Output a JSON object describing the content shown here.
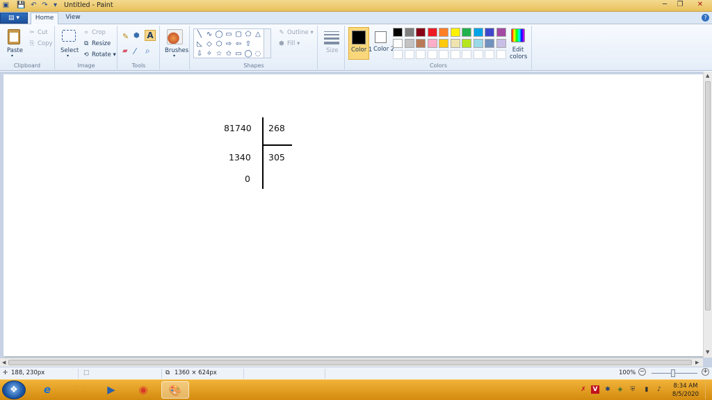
{
  "window": {
    "title": "Untitled - Paint",
    "controls": [
      "─",
      "❐",
      "✕"
    ]
  },
  "quick_access": [
    "▣",
    "💾",
    "↶",
    "↷",
    "▾"
  ],
  "tabs": {
    "file": "▤ ▾",
    "home": "Home",
    "view": "View",
    "help": "?"
  },
  "ribbon": {
    "clipboard": {
      "label": "Clipboard",
      "paste": "Paste",
      "paste_arrow": "▾",
      "cut": "Cut",
      "copy": "Copy"
    },
    "image": {
      "label": "Image",
      "select": "Select",
      "select_arrow": "▾",
      "crop": "Crop",
      "resize": "Resize",
      "rotate": "Rotate ▾"
    },
    "tools": {
      "label": "Tools",
      "pencil": "✎",
      "fill": "⬢",
      "text": "A",
      "eraser": "▰",
      "picker": "⁄",
      "magnifier": "⌕"
    },
    "brushes": {
      "label": "Brushes",
      "arrow": "▾"
    },
    "shapes": {
      "label": "Shapes",
      "glyphs": [
        "╲",
        "∿",
        "◯",
        "▭",
        "▢",
        "⬠",
        "△",
        "◺",
        "◇",
        "⬡",
        "⇨",
        "⇦",
        "⇧",
        "⇩",
        "✧",
        "☆",
        "✩",
        "▭",
        "◯",
        "◌"
      ],
      "outline": "Outline ▾",
      "fill": "Fill ▾"
    },
    "size": {
      "label": "Size"
    },
    "colors": {
      "label": "Colors",
      "color1": "Color 1",
      "color2": "Color 2",
      "edit": "Edit colors",
      "color1_value": "#000000",
      "color2_value": "#ffffff",
      "row1": [
        "#000000",
        "#7f7f7f",
        "#880015",
        "#ed1c24",
        "#ff7f27",
        "#fff200",
        "#22b14c",
        "#00a2e8",
        "#3f48cc",
        "#a349a4"
      ],
      "row2": [
        "#ffffff",
        "#c3c3c3",
        "#b97a57",
        "#ffaec9",
        "#ffc90e",
        "#efe4b0",
        "#b5e61d",
        "#99d9ea",
        "#7092be",
        "#c8bfe7"
      ],
      "row3": [
        "#ffffff",
        "#ffffff",
        "#ffffff",
        "#ffffff",
        "#ffffff",
        "#ffffff",
        "#ffffff",
        "#ffffff",
        "#ffffff",
        "#ffffff"
      ]
    }
  },
  "canvas_text": {
    "dividend": "81740",
    "divisor": "268",
    "product": "1340",
    "quotient": "305",
    "remainder": "0"
  },
  "status": {
    "cursor": "188, 230px",
    "canvas_size": "1360 × 624px",
    "zoom": "100%",
    "zoom_out": "−",
    "zoom_in": "+"
  },
  "taskbar": {
    "start": "❖",
    "apps": [
      {
        "name": "internet-explorer",
        "glyph": "e"
      },
      {
        "name": "file-explorer",
        "glyph": "🗀"
      },
      {
        "name": "media-player",
        "glyph": "▶"
      },
      {
        "name": "chrome",
        "glyph": "◉"
      },
      {
        "name": "paint",
        "glyph": "🎨"
      }
    ],
    "tray": [
      "✗",
      "V",
      "✱",
      "◈",
      "⛨",
      "▮",
      "♪"
    ],
    "time": "8:34 AM",
    "date": "8/5/2020"
  }
}
